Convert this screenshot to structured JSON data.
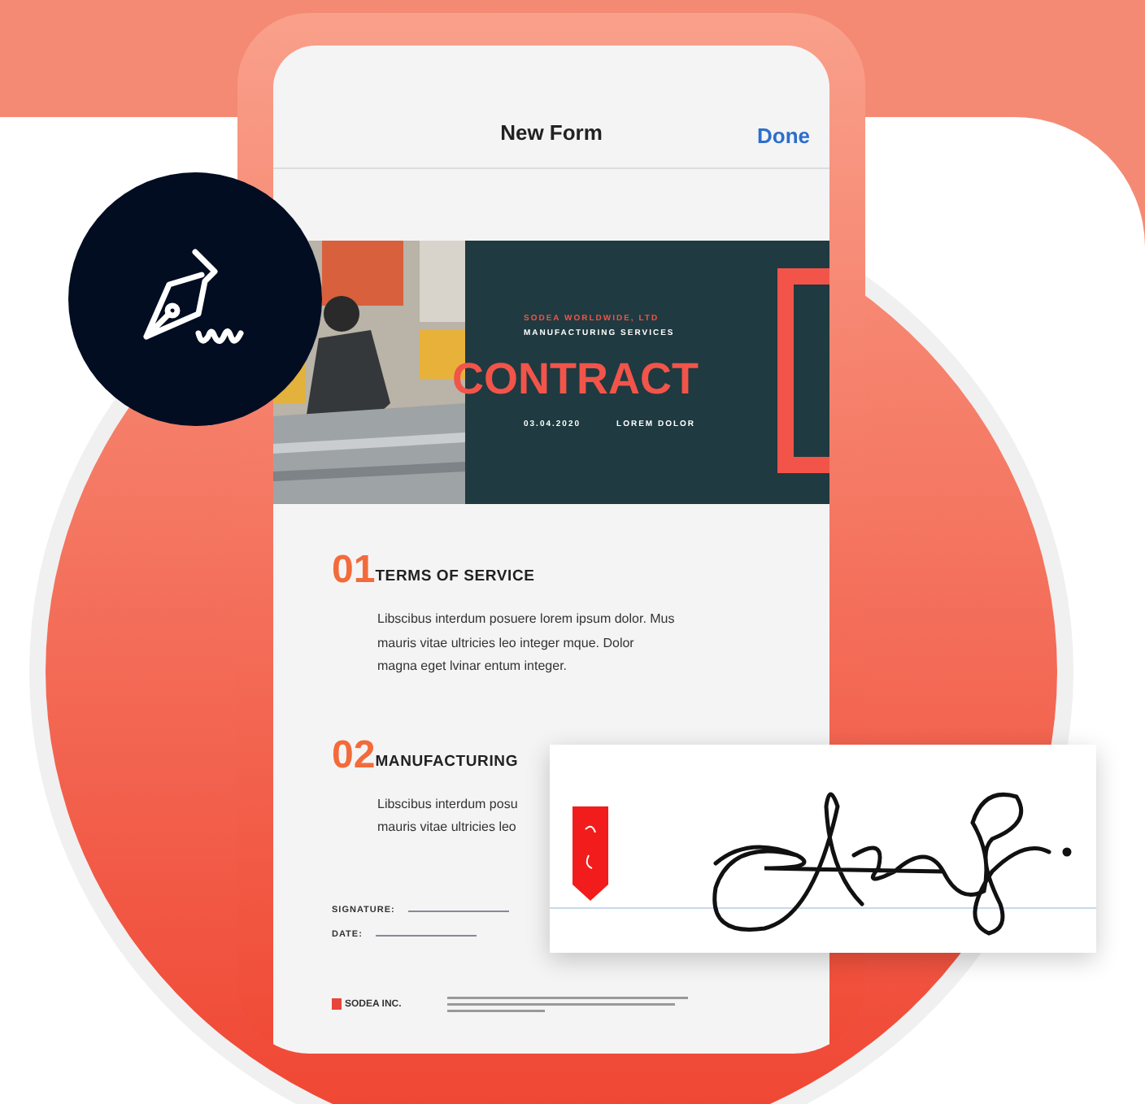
{
  "header": {
    "title": "New Form",
    "action": "Done"
  },
  "banner": {
    "company": "SODEA WORLDWIDE, LTD",
    "subtitle": "MANUFACTURING SERVICES",
    "title": "CONTRACT",
    "date": "03.04.2020",
    "note": "LOREM DOLOR"
  },
  "sections": [
    {
      "number": "01",
      "heading": "TERMS OF SERVICE",
      "lines": [
        "Libscibus interdum posuere lorem ipsum dolor. Mus",
        "mauris vitae ultricies leo integer mque. Dolor",
        "magna eget lvinar entum integer."
      ]
    },
    {
      "number": "02",
      "heading": "MANUFACTURING",
      "lines": [
        "Libscibus interdum posu",
        "mauris vitae ultricies leo"
      ]
    }
  ],
  "fields": [
    "SIGNATURE:",
    "DATE:"
  ],
  "footer": {
    "logo": "SODEA INC."
  }
}
